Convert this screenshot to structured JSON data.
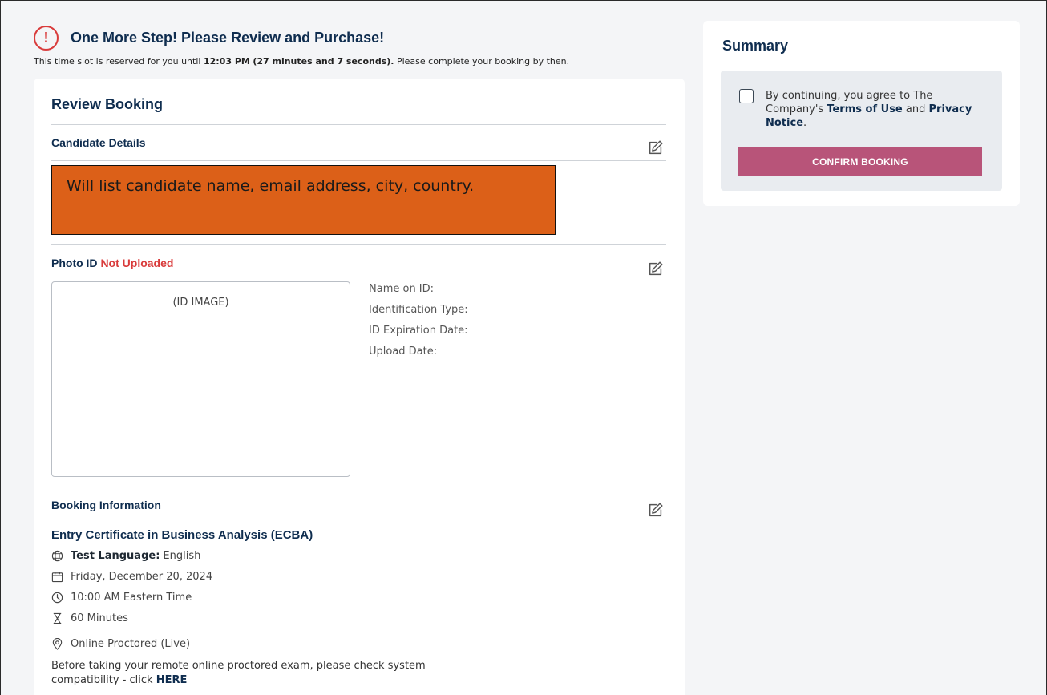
{
  "header": {
    "title": "One More Step! Please Review and Purchase!",
    "reserve_prefix": "This time slot is reserved for you until",
    "reserve_time": "12:03 PM",
    "reserve_countdown": "(27 minutes and 7 seconds).",
    "reserve_suffix": "Please complete your booking by then."
  },
  "review": {
    "title": "Review Booking",
    "candidate": {
      "title": "Candidate Details",
      "placeholder": "Will list candidate name, email address, city, country."
    },
    "photo_id": {
      "title": "Photo ID",
      "status": "Not Uploaded",
      "image_label": "(ID IMAGE)",
      "fields": [
        "Name on ID:",
        "Identification Type:",
        "ID Expiration Date:",
        "Upload Date:"
      ]
    },
    "booking": {
      "title": "Booking Information",
      "course": "Entry Certificate in Business Analysis (ECBA)",
      "language_label": "Test Language:",
      "language_value": "English",
      "date": "Friday, December 20, 2024",
      "time": "10:00 AM Eastern Time",
      "duration": "60 Minutes",
      "delivery": "Online Proctored (Live)",
      "note": "Before taking your remote online proctored exam, please check system compatibility - click",
      "note_link": "HERE"
    }
  },
  "summary": {
    "title": "Summary",
    "agree_prefix": "By continuing, you agree to The Company's",
    "terms_link": "Terms of Use",
    "and": "and",
    "privacy_link": "Privacy Notice",
    "period": ".",
    "confirm_label": "CONFIRM BOOKING"
  },
  "colors": {
    "accent": "#0f2d4f",
    "alert": "#d93b3b",
    "placeholder_fill": "#dc6018",
    "confirm_button": "#b85479"
  },
  "icons": [
    "alert-icon",
    "edit-icon",
    "globe-icon",
    "calendar-icon",
    "clock-icon",
    "hourglass-icon",
    "location-icon"
  ]
}
